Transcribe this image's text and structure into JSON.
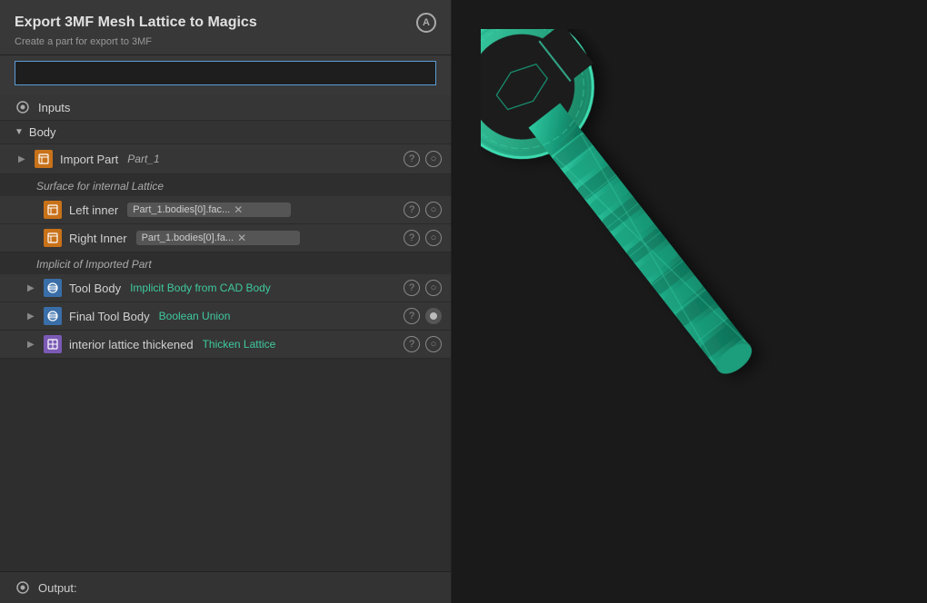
{
  "panel": {
    "title": "Export 3MF Mesh Lattice to Magics",
    "subtitle": "Create a part for export to 3MF",
    "title_icon": "A",
    "name_input_placeholder": "",
    "name_input_value": ""
  },
  "sections": {
    "inputs_label": "Inputs",
    "body_label": "Body"
  },
  "rows": {
    "import_part": {
      "label": "Import Part",
      "tag": "Part_1",
      "question": "?",
      "circle": "○"
    },
    "surface_label": "Surface for internal Lattice",
    "left_inner": {
      "label": "Left inner",
      "value": "Part_1.bodies[0].fac...",
      "question": "?",
      "circle": "○"
    },
    "right_inner": {
      "label": "Right Inner",
      "value": "Part_1.bodies[0].fa...",
      "question": "?",
      "circle": "○"
    },
    "implicit_label": "Implicit of Imported Part",
    "tool_body": {
      "label": "Tool Body",
      "value": "Implicit Body from CAD Body",
      "question": "?",
      "circle": "○"
    },
    "final_tool_body": {
      "label": "Final Tool Body",
      "value": "Boolean Union",
      "question": "?",
      "dot": "●"
    },
    "interior_lattice": {
      "label": "interior lattice thickened",
      "value": "Thicken Lattice",
      "question": "?",
      "circle": "○"
    }
  },
  "output": {
    "label": "Output:"
  },
  "icons": {
    "gear": "⚙",
    "expand": "▶",
    "collapse": "▼",
    "arrow_right": "▶",
    "inputs_symbol": "⊙",
    "box_symbol": "▣"
  }
}
